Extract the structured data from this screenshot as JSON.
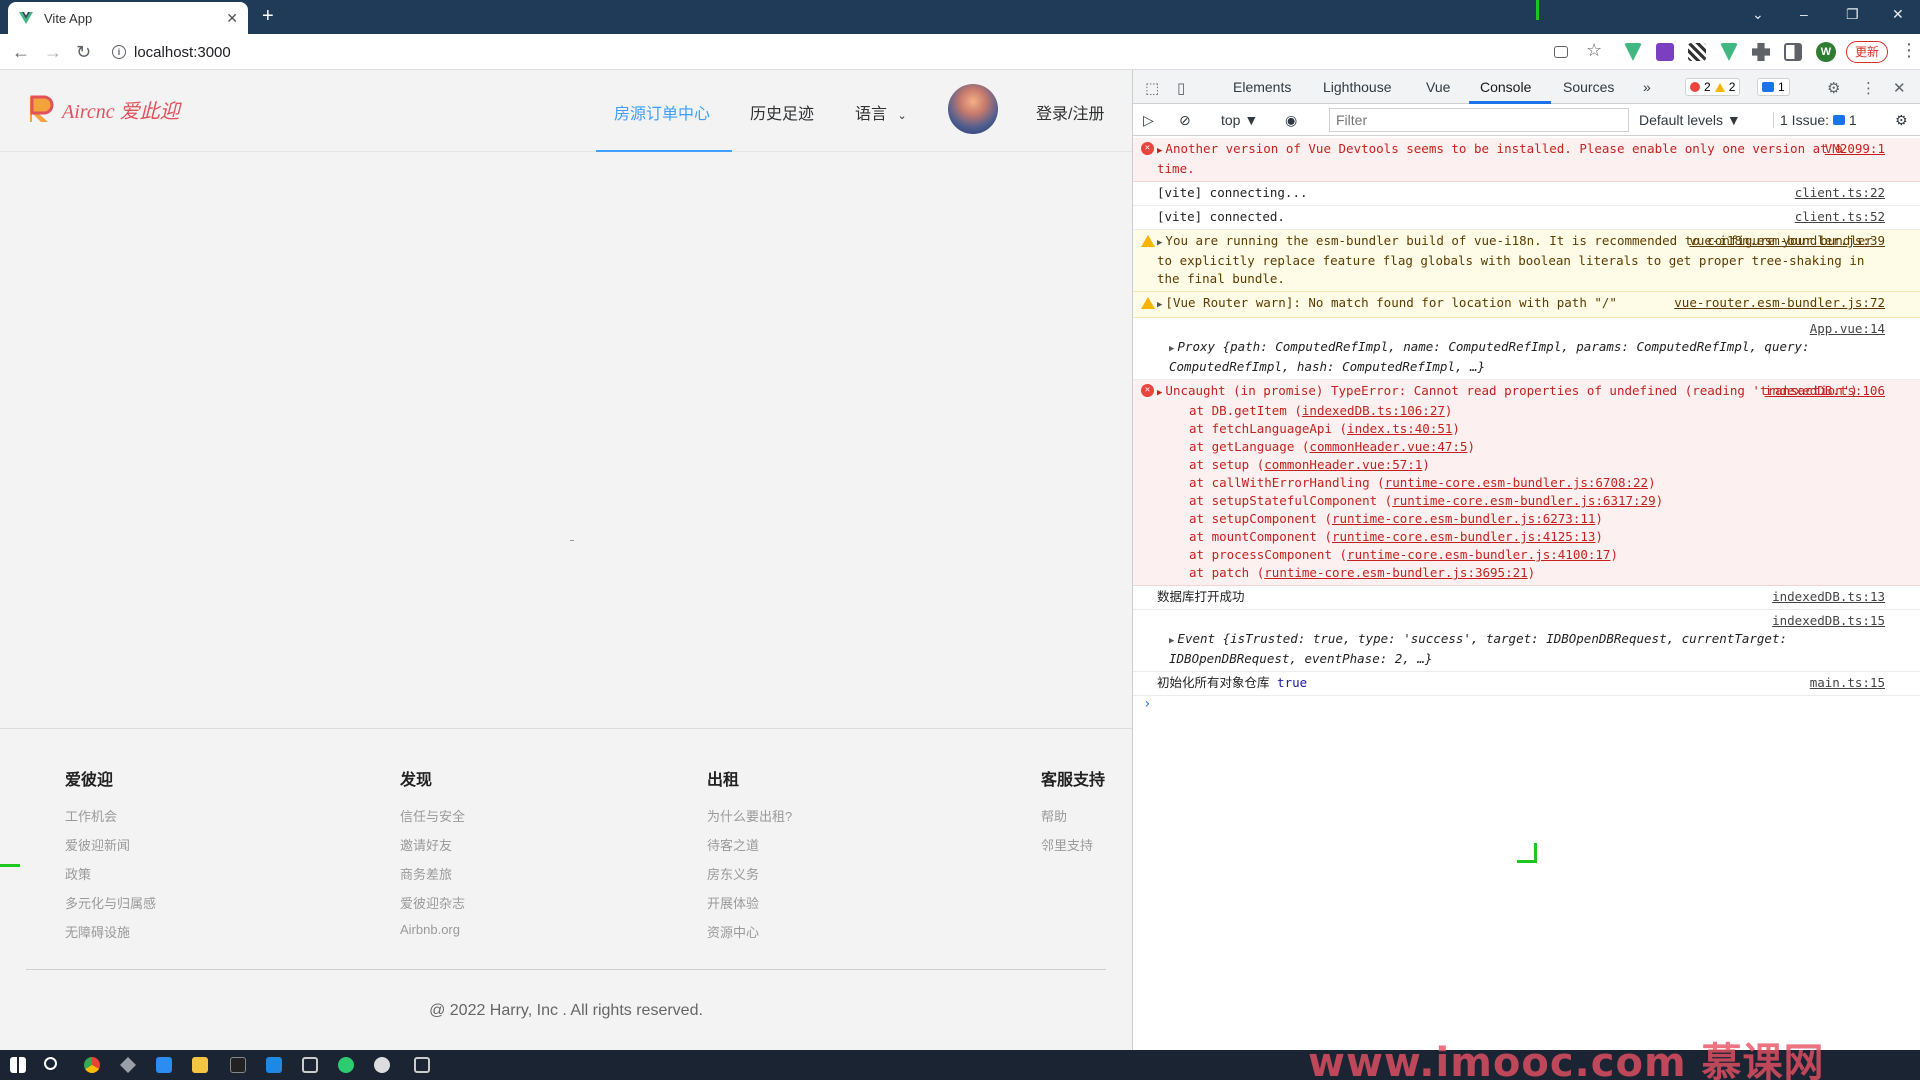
{
  "browser": {
    "tab_title": "Vite App",
    "tab_close": "✕",
    "new_tab": "+",
    "url": "localhost:3000",
    "update_label": "更新",
    "profile_initial": "W",
    "back": "←",
    "forward": "→",
    "reload": "↻",
    "minimize": "–",
    "restore": "❐",
    "close": "✕",
    "tabs_dropdown": "⌄"
  },
  "site": {
    "brand": "Aircnc 爱此迎",
    "nav": {
      "orders": "房源订单中心",
      "history": "历史足迹",
      "language": "语言",
      "login": "登录/注册"
    },
    "footer": {
      "columns": [
        {
          "heading": "爱彼迎",
          "links": [
            "工作机会",
            "爱彼迎新闻",
            "政策",
            "多元化与归属感",
            "无障碍设施"
          ]
        },
        {
          "heading": "发现",
          "links": [
            "信任与安全",
            "邀请好友",
            "商务差旅",
            "爱彼迎杂志",
            "Airbnb.org"
          ]
        },
        {
          "heading": "出租",
          "links": [
            "为什么要出租?",
            "待客之道",
            "房东义务",
            "开展体验",
            "资源中心"
          ]
        },
        {
          "heading": "客服支持",
          "links": [
            "帮助",
            "邻里支持"
          ]
        }
      ],
      "copyright": "@ 2022 Harry, Inc . All rights reserved."
    }
  },
  "devtools": {
    "tabs": [
      "Elements",
      "Lighthouse",
      "Vue",
      "Console",
      "Sources"
    ],
    "more_tabs": "»",
    "error_count": "2",
    "warning_count": "2",
    "message_count": "1",
    "context": "top ▼",
    "filter_placeholder": "Filter",
    "levels": "Default levels ▼",
    "issues_label": "1 Issue:",
    "issues_count": "1",
    "console": {
      "devtools_error": {
        "text": "Another version of Vue Devtools seems to be installed. Please enable only one version at a time.",
        "source": "VM2099:1"
      },
      "vite_connecting": {
        "text": "[vite] connecting...",
        "source": "client.ts:22"
      },
      "vite_connected": {
        "text": "[vite] connected.",
        "source": "client.ts:52"
      },
      "i18n_warn": {
        "text": "You are running the esm-bundler build of vue-i18n. It is recommended to configure your bundler to explicitly replace feature flag globals with boolean literals to get proper tree-shaking in the final bundle.",
        "source": "vue-i18n.esm-bundler.js:39"
      },
      "router_warn": {
        "text": "[Vue Router warn]: No match found for location with path \"/\"",
        "source": "vue-router.esm-bundler.js:72"
      },
      "proxy_log": {
        "source": "App.vue:14",
        "text": "Proxy {path: ComputedRefImpl, name: ComputedRefImpl, params: ComputedRefImpl, query: ComputedRefImpl, hash: ComputedRefImpl, …}"
      },
      "uncaught": {
        "text": "Uncaught (in promise) TypeError: Cannot read properties of undefined (reading 'transaction')",
        "source": "indexedDB.ts:106",
        "stack": [
          {
            "fn": "at DB.getItem (",
            "loc": "indexedDB.ts:106:27",
            "end": ")"
          },
          {
            "fn": "at fetchLanguageApi (",
            "loc": "index.ts:40:51",
            "end": ")"
          },
          {
            "fn": "at getLanguage (",
            "loc": "commonHeader.vue:47:5",
            "end": ")"
          },
          {
            "fn": "at setup (",
            "loc": "commonHeader.vue:57:1",
            "end": ")"
          },
          {
            "fn": "at callWithErrorHandling (",
            "loc": "runtime-core.esm-bundler.js:6708:22",
            "end": ")"
          },
          {
            "fn": "at setupStatefulComponent (",
            "loc": "runtime-core.esm-bundler.js:6317:29",
            "end": ")"
          },
          {
            "fn": "at setupComponent (",
            "loc": "runtime-core.esm-bundler.js:6273:11",
            "end": ")"
          },
          {
            "fn": "at mountComponent (",
            "loc": "runtime-core.esm-bundler.js:4125:13",
            "end": ")"
          },
          {
            "fn": "at processComponent (",
            "loc": "runtime-core.esm-bundler.js:4100:17",
            "end": ")"
          },
          {
            "fn": "at patch (",
            "loc": "runtime-core.esm-bundler.js:3695:21",
            "end": ")"
          }
        ]
      },
      "db_open": {
        "text": "数据库打开成功",
        "source": "indexedDB.ts:13"
      },
      "event_log": {
        "source": "indexedDB.ts:15",
        "text": "Event {isTrusted: true, type: 'success', target: IDBOpenDBRequest, currentTarget: IDBOpenDBRequest, eventPhase: 2, …}"
      },
      "init_log": {
        "text": "初始化所有对象仓库",
        "value": "true",
        "source": "main.ts:15"
      },
      "prompt": "›"
    }
  },
  "watermark": "www.imooc.com 慕课网",
  "colors": {
    "accent": "#409eff",
    "brand": "#e2525c",
    "error": "#c5221f",
    "warn_bg": "#fefbe6",
    "error_bg": "#fdf0f0"
  }
}
